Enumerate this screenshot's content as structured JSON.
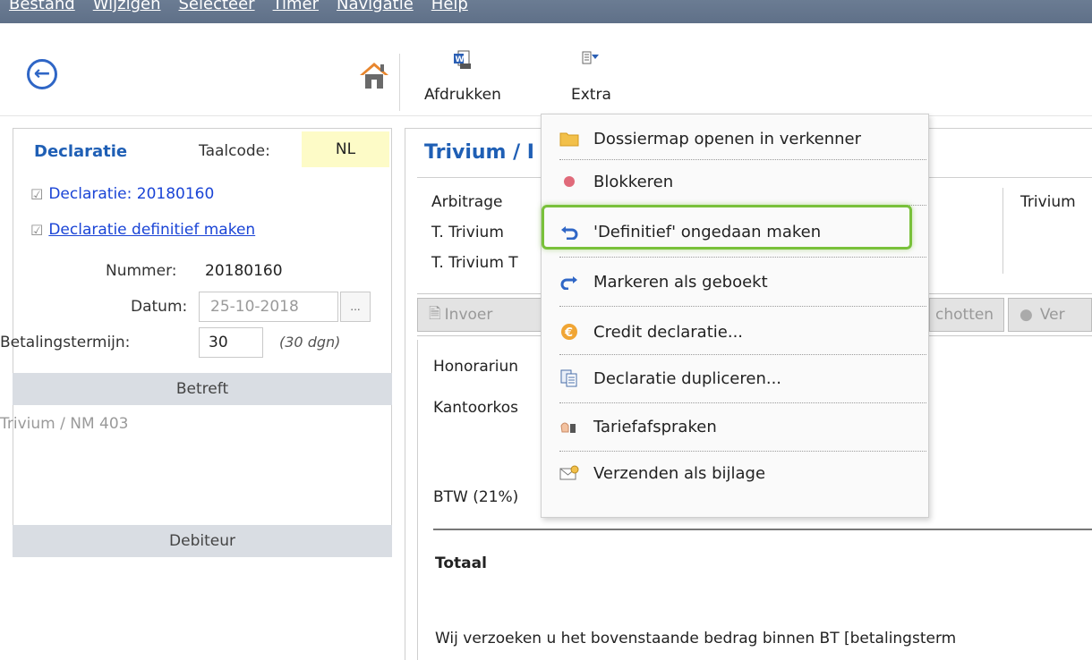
{
  "menubar": {
    "items": [
      {
        "label": "Bestand"
      },
      {
        "label": "Wijzigen"
      },
      {
        "label": "Selecteer"
      },
      {
        "label": "Timer"
      },
      {
        "label": "Navigatie"
      },
      {
        "label": "Help"
      }
    ]
  },
  "toolbar": {
    "back_icon": "back-arrow-icon",
    "home_icon": "home-icon",
    "print_label": "Afdrukken",
    "extra_label": "Extra"
  },
  "left": {
    "declaratie_heading": "Declaratie",
    "taalcode_label": "Taalcode:",
    "taalcode_value": "NL",
    "decl_link": "Declaratie: 20180160",
    "definitief_link": "Declaratie definitief maken",
    "nummer_label": "Nummer:",
    "nummer_value": "20180160",
    "datum_label": "Datum:",
    "datum_value": "25-10-2018",
    "datum_button": "...",
    "termijn_label": "Betalingstermijn:",
    "termijn_value": "30",
    "termijn_note": "(30 dgn)",
    "betreft_header": "Betreft",
    "betreft_text": "Trivium / NM 403",
    "debiteur_header": "Debiteur"
  },
  "right": {
    "title": "Trivium / I",
    "line1": "Arbitrage",
    "line2": "T. Trivium",
    "line3": "T. Trivium T",
    "side_text": "Trivium",
    "tab_invoer": "Invoer",
    "tab_schotten": "chotten",
    "tab_ver": "Ver",
    "honorarium": "Honorariun",
    "kantoorkosten": "Kantoorkos",
    "btw": "BTW (21%)",
    "totaal": "Totaal",
    "footer_text": "Wij verzoeken u het bovenstaande bedrag binnen BT [betalingsterm"
  },
  "dropdown": {
    "items": [
      {
        "label": "Dossiermap openen in verkenner",
        "icon": "folder-icon"
      },
      {
        "label": "Blokkeren",
        "icon": "red-dot-icon"
      },
      {
        "label": "'Definitief' ongedaan maken",
        "icon": "undo-arrow-icon"
      },
      {
        "label": "Markeren als geboekt",
        "icon": "redo-arrow-icon"
      },
      {
        "label": "Credit declaratie...",
        "icon": "euro-coin-icon"
      },
      {
        "label": "Declaratie dupliceren...",
        "icon": "duplicate-icon"
      },
      {
        "label": "Tariefafspraken",
        "icon": "handshake-icon"
      },
      {
        "label": "Verzenden als bijlage",
        "icon": "mail-attachment-icon"
      }
    ]
  },
  "colors": {
    "menubar": "#5f7088",
    "accent_blue": "#1f5fb5",
    "link_blue": "#1a44d6",
    "highlight_green": "#79c13a",
    "taalcode_bg": "#fdfbc7",
    "section_bar": "#d9dde3"
  }
}
